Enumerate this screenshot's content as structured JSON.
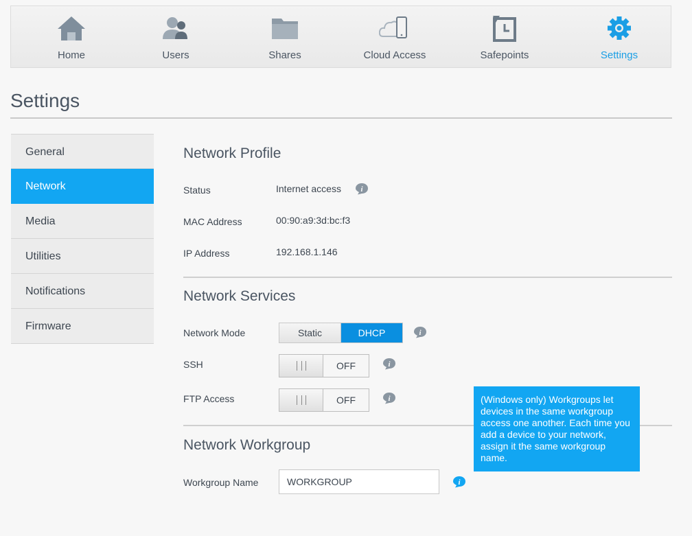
{
  "nav": {
    "items": [
      {
        "label": "Home",
        "icon": "home-icon"
      },
      {
        "label": "Users",
        "icon": "users-icon"
      },
      {
        "label": "Shares",
        "icon": "folder-icon"
      },
      {
        "label": "Cloud Access",
        "icon": "cloud-device-icon"
      },
      {
        "label": "Safepoints",
        "icon": "safepoint-icon"
      },
      {
        "label": "Settings",
        "icon": "gear-icon"
      }
    ],
    "active": "Settings"
  },
  "page": {
    "title": "Settings"
  },
  "sidebar": {
    "items": [
      {
        "label": "General"
      },
      {
        "label": "Network"
      },
      {
        "label": "Media"
      },
      {
        "label": "Utilities"
      },
      {
        "label": "Notifications"
      },
      {
        "label": "Firmware"
      }
    ],
    "active": "Network"
  },
  "profile": {
    "title": "Network Profile",
    "status_label": "Status",
    "status_value": "Internet access",
    "mac_label": "MAC Address",
    "mac_value": "00:90:a9:3d:bc:f3",
    "ip_label": "IP Address",
    "ip_value": "192.168.1.146"
  },
  "services": {
    "title": "Network Services",
    "mode_label": "Network Mode",
    "mode_options": [
      "Static",
      "DHCP"
    ],
    "mode_selected": "DHCP",
    "ssh_label": "SSH",
    "ssh_state": "OFF",
    "ftp_label": "FTP Access",
    "ftp_state": "OFF"
  },
  "workgroup": {
    "title": "Network Workgroup",
    "name_label": "Workgroup Name",
    "name_value": "WORKGROUP"
  },
  "tooltip": {
    "text": "(Windows only) Workgroups let devices in the same workgroup access one another. Each time you add a device to your network, assign it the same workgroup name."
  },
  "colors": {
    "accent": "#12a6f2",
    "selected_segment": "#0a8fe0",
    "icon_gray": "#7f8e9c"
  }
}
